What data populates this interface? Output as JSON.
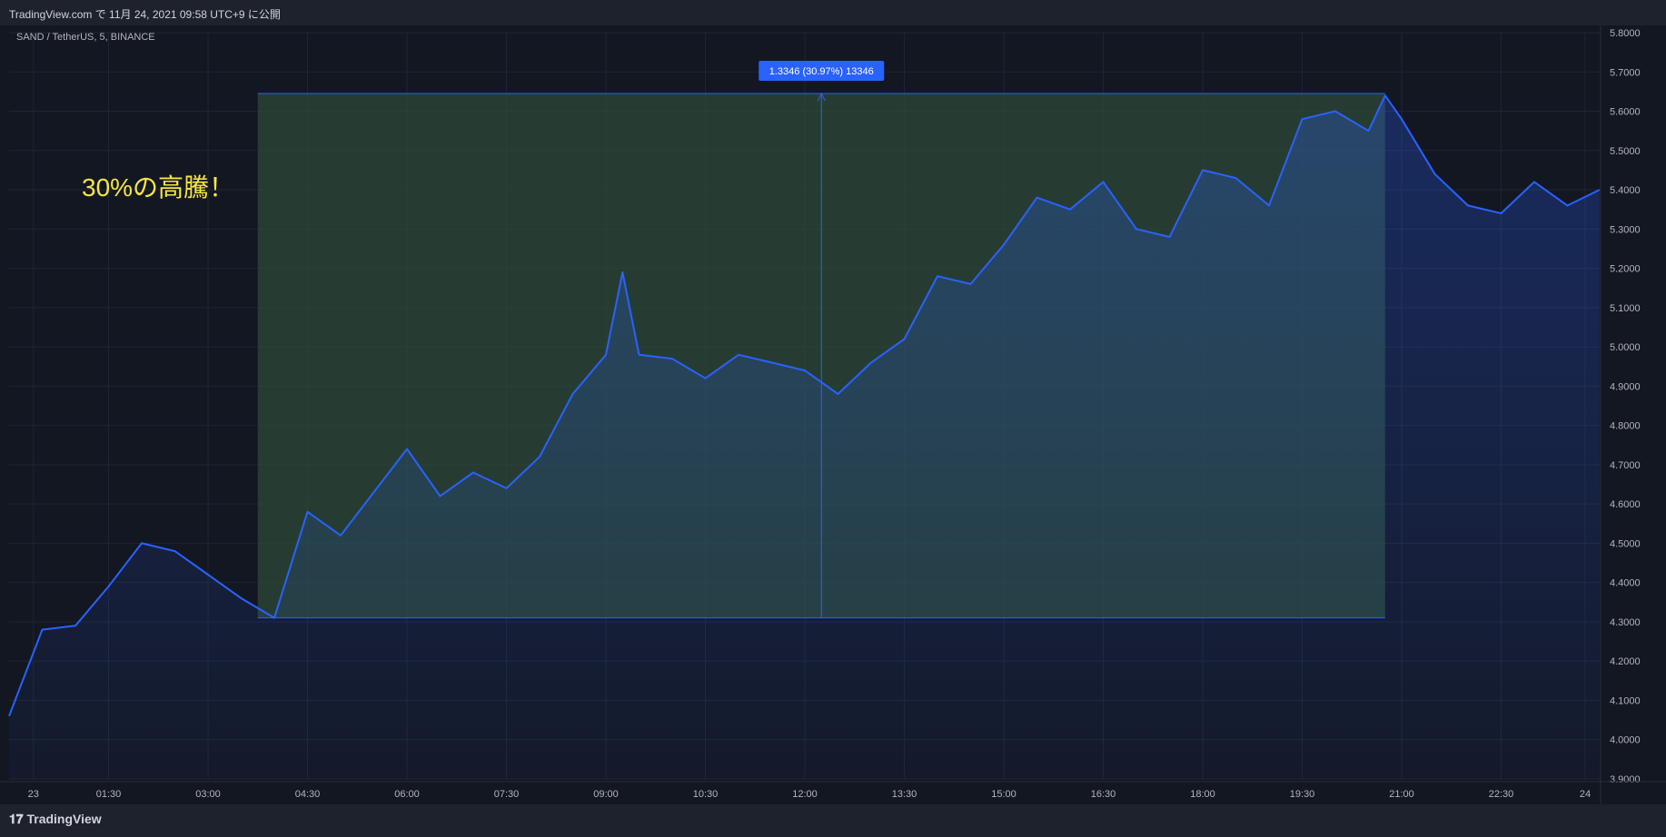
{
  "header": {
    "published_text": "TradingView.com で 11月 24, 2021 09:58 UTC+9 に公開"
  },
  "footer": {
    "logo_text": "TradingView"
  },
  "colors": {
    "background": "#131722",
    "line": "#2962ff",
    "measure_fill": "#2e4a3a",
    "measure_label_bg": "#2962ff",
    "annotation": "#f5e642"
  },
  "chart_data": {
    "type": "area",
    "title": "SAND / TetherUS, 5, BINANCE",
    "annotation": "30%の高騰！",
    "measure_label": "1.3346 (30.97%) 13346",
    "measure_range": {
      "start": "03:45",
      "end": "20:45",
      "low": 4.31,
      "high": 5.645
    },
    "xlabel": "",
    "ylabel": "",
    "ylim": [
      3.9,
      5.8
    ],
    "y_ticks": [
      "5.8000",
      "5.7000",
      "5.6000",
      "5.5000",
      "5.4000",
      "5.3000",
      "5.2000",
      "5.1000",
      "5.0000",
      "4.9000",
      "4.8000",
      "4.7000",
      "4.6000",
      "4.5000",
      "4.4000",
      "4.3000",
      "4.2000",
      "4.1000",
      "4.0000",
      "3.9000"
    ],
    "x_ticks": [
      "23",
      "01:30",
      "03:00",
      "04:30",
      "06:00",
      "07:30",
      "09:00",
      "10:30",
      "12:00",
      "13:30",
      "15:00",
      "16:30",
      "18:00",
      "19:30",
      "21:00",
      "22:30",
      "24"
    ],
    "grid": true,
    "series": [
      {
        "x": [
          "00:00",
          "00:30",
          "01:00",
          "01:30",
          "02:00",
          "02:30",
          "03:00",
          "03:30",
          "04:00",
          "04:30",
          "05:00",
          "05:30",
          "06:00",
          "06:30",
          "07:00",
          "07:30",
          "08:00",
          "08:30",
          "09:00",
          "09:15",
          "09:30",
          "10:00",
          "10:30",
          "11:00",
          "11:30",
          "12:00",
          "12:30",
          "13:00",
          "13:30",
          "14:00",
          "14:30",
          "15:00",
          "15:30",
          "16:00",
          "16:30",
          "17:00",
          "17:30",
          "18:00",
          "18:30",
          "19:00",
          "19:30",
          "20:00",
          "20:30",
          "20:45",
          "21:00",
          "21:30",
          "22:00",
          "22:30",
          "23:00",
          "23:30",
          "23:59"
        ],
        "values": [
          4.06,
          4.28,
          4.29,
          4.39,
          4.5,
          4.48,
          4.42,
          4.36,
          4.31,
          4.58,
          4.52,
          4.63,
          4.74,
          4.62,
          4.68,
          4.64,
          4.72,
          4.88,
          4.98,
          5.19,
          4.98,
          4.97,
          4.92,
          4.98,
          4.96,
          4.94,
          4.88,
          4.96,
          5.02,
          5.18,
          5.16,
          5.26,
          5.38,
          5.35,
          5.42,
          5.3,
          5.28,
          5.45,
          5.43,
          5.36,
          5.58,
          5.6,
          5.55,
          5.64,
          5.58,
          5.44,
          5.36,
          5.34,
          5.42,
          5.36,
          5.4
        ]
      }
    ]
  }
}
